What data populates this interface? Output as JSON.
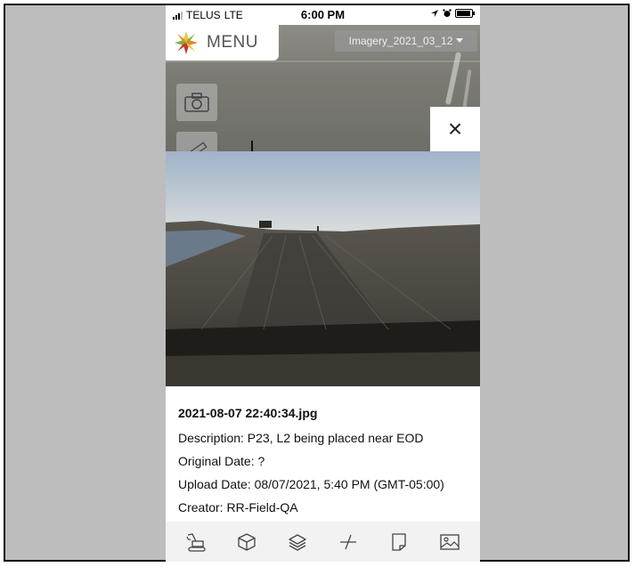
{
  "status_bar": {
    "carrier": "TELUS",
    "network": "LTE",
    "time": "6:00 PM"
  },
  "header": {
    "menu_label": "MENU",
    "imagery_selected": "Imagery_2021_03_12"
  },
  "viewer": {
    "close_glyph": "×"
  },
  "photo_info": {
    "filename": "2021-08-07 22:40:34.jpg",
    "description": "Description: P23, L2 being placed near EOD",
    "original_date": "Original Date: ?",
    "upload_date": "Upload Date: 08/07/2021, 5:40 PM (GMT-05:00)",
    "creator": "Creator: RR-Field-QA"
  },
  "bottom_nav": [
    {
      "icon": "excavator-icon"
    },
    {
      "icon": "cube-icon"
    },
    {
      "icon": "layers-icon"
    },
    {
      "icon": "measure-icon"
    },
    {
      "icon": "document-icon"
    },
    {
      "icon": "image-icon"
    }
  ],
  "colors": {
    "logo_orange": "#e8842a",
    "logo_green": "#7fae3c",
    "logo_red": "#c0392b",
    "logo_yellow": "#f1c232",
    "background": "#bdbdbd"
  }
}
